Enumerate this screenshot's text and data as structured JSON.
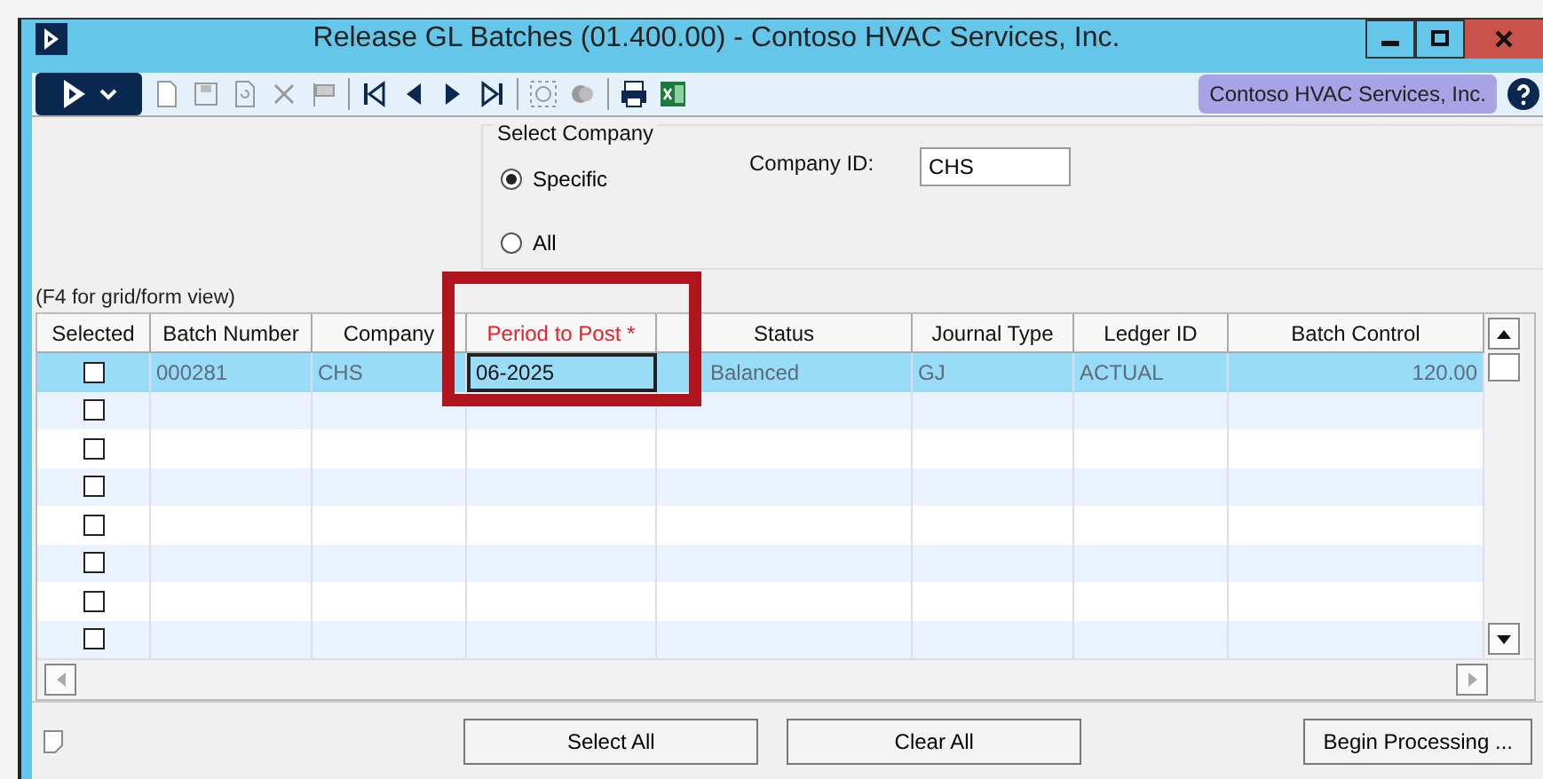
{
  "window": {
    "title": "Release GL Batches (01.400.00) - Contoso HVAC Services, Inc."
  },
  "toolbar": {
    "company_badge": "Contoso HVAC Services, Inc."
  },
  "select_company": {
    "title": "Select Company",
    "options": [
      {
        "label": "Specific",
        "selected": true
      },
      {
        "label": "All",
        "selected": false
      }
    ],
    "company_id_label": "Company ID:",
    "company_id": "CHS"
  },
  "grid_hint": "(F4 for grid/form view)",
  "table": {
    "columns": [
      {
        "label": "Selected",
        "required": false
      },
      {
        "label": "Batch Number",
        "required": false
      },
      {
        "label": "Company",
        "required": false
      },
      {
        "label": "Period to Post *",
        "required": true
      },
      {
        "label": "Status",
        "required": false
      },
      {
        "label": "Journal Type",
        "required": false
      },
      {
        "label": "Ledger ID",
        "required": false
      },
      {
        "label": "Batch Control",
        "required": false
      }
    ],
    "rows": [
      {
        "selected": true,
        "checked": false,
        "cells": [
          "",
          "000281",
          "CHS",
          "06-2025",
          "Balanced",
          "GJ",
          "ACTUAL",
          "120.00"
        ]
      },
      {
        "selected": false,
        "checked": false,
        "cells": []
      },
      {
        "selected": false,
        "checked": false,
        "cells": []
      },
      {
        "selected": false,
        "checked": false,
        "cells": []
      },
      {
        "selected": false,
        "checked": false,
        "cells": []
      },
      {
        "selected": false,
        "checked": false,
        "cells": []
      },
      {
        "selected": false,
        "checked": false,
        "cells": []
      },
      {
        "selected": false,
        "checked": false,
        "cells": []
      }
    ]
  },
  "buttons": [
    "Select All",
    "Clear All",
    "Begin Processing ..."
  ]
}
